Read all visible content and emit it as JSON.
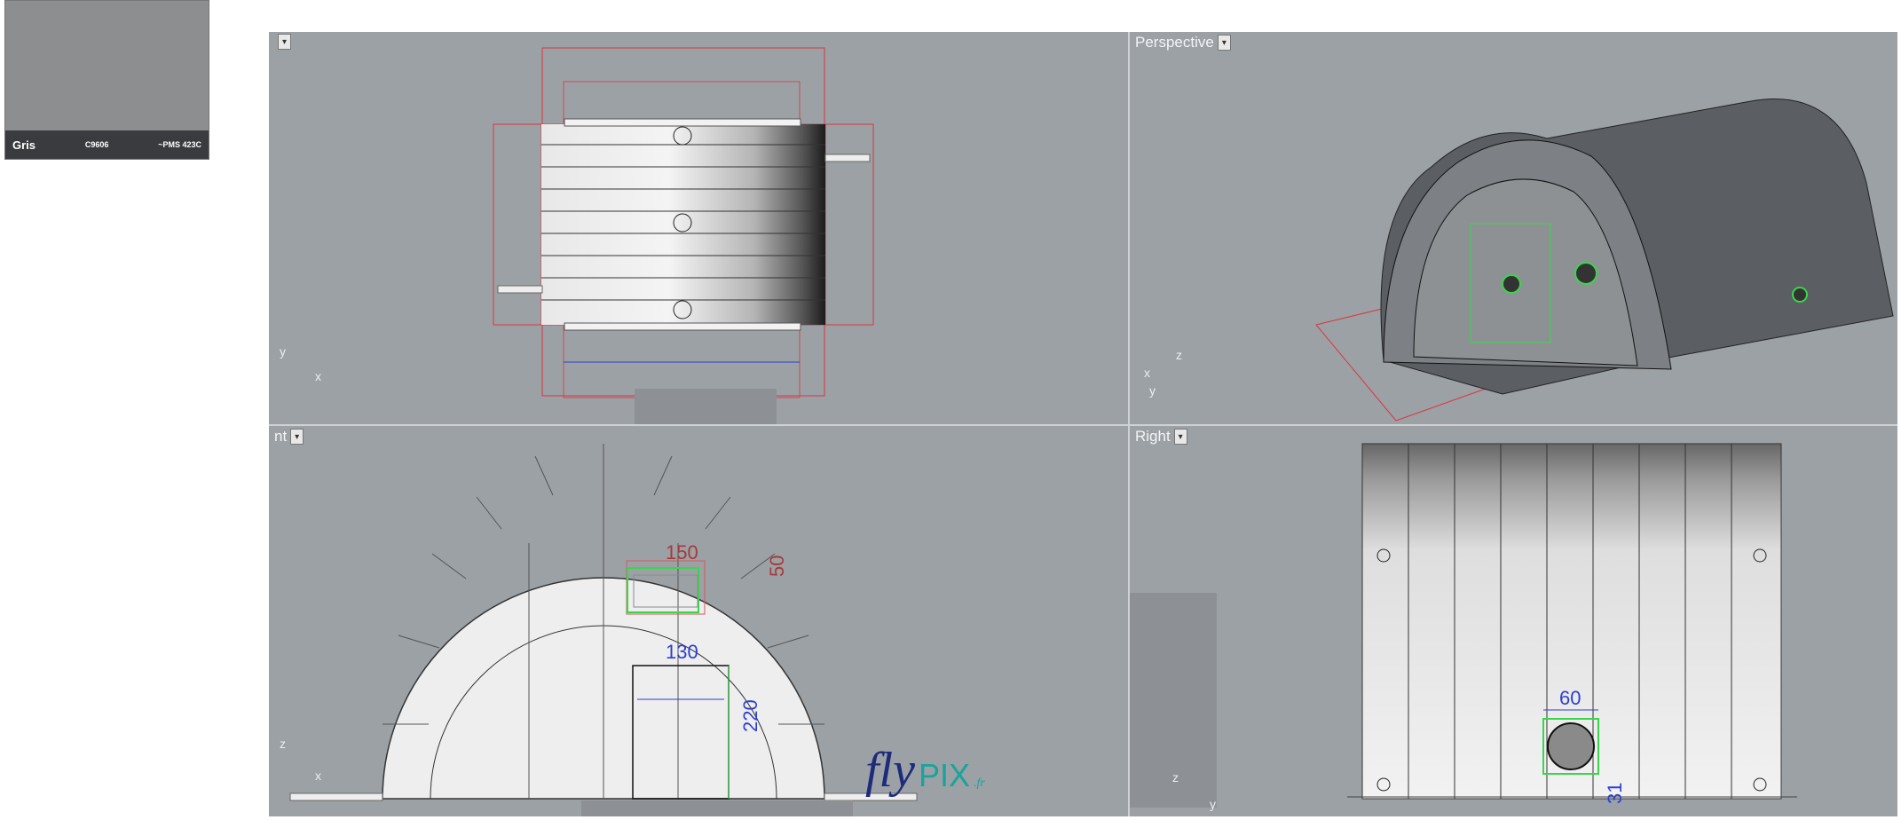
{
  "swatch": {
    "name": "Gris",
    "code": "C9606",
    "pms": "~PMS 423C",
    "color": "#8c8e90"
  },
  "viewports": {
    "top": {
      "title": ""
    },
    "perspective": {
      "title": "Perspective"
    },
    "front": {
      "title": "nt"
    },
    "right": {
      "title": "Right"
    }
  },
  "dimensions": {
    "front_window_width": "150",
    "front_window_height": "50",
    "front_door_width": "130",
    "front_door_height": "220",
    "right_hole_diameter": "60",
    "right_hole_offset": "31"
  },
  "axes": {
    "x": "x",
    "y": "y",
    "z": "z"
  },
  "logo": {
    "part1": "fly",
    "part2": "PIX",
    "part3": ".fr"
  },
  "colors": {
    "dimension_red": "#d9383f",
    "dimension_blue": "#2c3fd0",
    "outline_green": "#39d64a",
    "viewport_bg": "#9ca1a6"
  }
}
